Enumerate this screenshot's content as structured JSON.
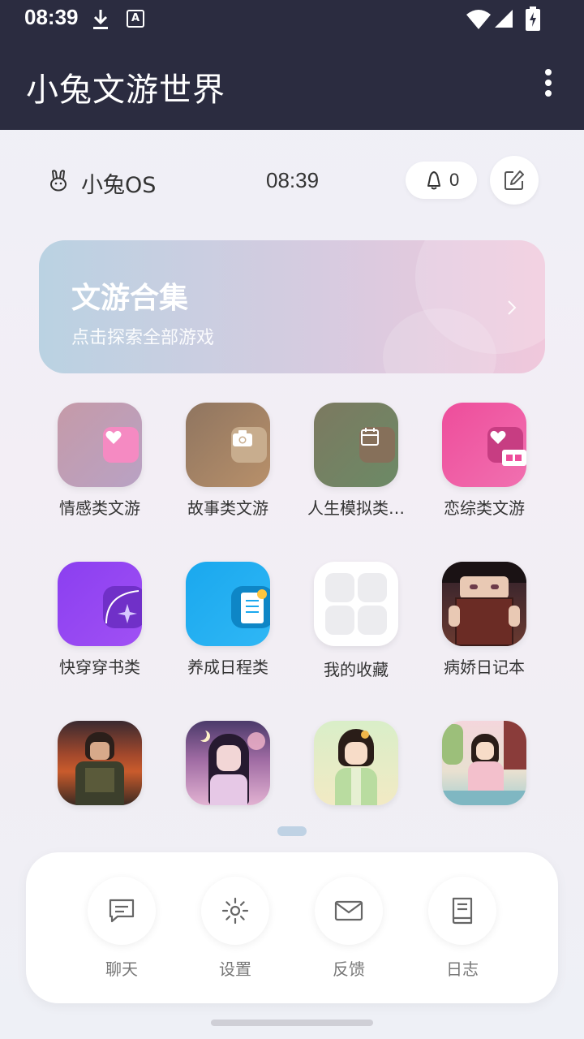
{
  "status_bar": {
    "time": "08:39",
    "keyboard_badge": "A"
  },
  "app_bar": {
    "title": "小兔文游世界"
  },
  "info_row": {
    "os_label": "小兔OS",
    "clock": "08:39",
    "notification_count": "0"
  },
  "banner": {
    "title": "文游合集",
    "subtitle": "点击探索全部游戏",
    "chevron": "›"
  },
  "apps": [
    {
      "label": "情感类文游",
      "icon": "heart-icon"
    },
    {
      "label": "故事类文游",
      "icon": "camera-icon"
    },
    {
      "label": "人生模拟类…",
      "icon": "calendar-icon"
    },
    {
      "label": "恋综类文游",
      "icon": "heart-icon"
    },
    {
      "label": "快穿穿书类",
      "icon": "sparkle-icon"
    },
    {
      "label": "养成日程类",
      "icon": "document-icon"
    },
    {
      "label": "我的收藏",
      "icon": "grid-icon"
    },
    {
      "label": "病娇日记本",
      "icon": "girl-reading-book-image"
    },
    {
      "label": "",
      "icon": "soldier-portrait-image"
    },
    {
      "label": "",
      "icon": "moonlit-girl-image"
    },
    {
      "label": "",
      "icon": "hanfu-girl-image"
    },
    {
      "label": "",
      "icon": "garden-girl-image"
    }
  ],
  "dock": [
    {
      "label": "聊天",
      "icon": "chat-icon"
    },
    {
      "label": "设置",
      "icon": "gear-icon"
    },
    {
      "label": "反馈",
      "icon": "mail-icon"
    },
    {
      "label": "日志",
      "icon": "book-icon"
    }
  ],
  "colors": {
    "app_bar": "#2b2c40",
    "accent_pink": "#ee4d9b",
    "accent_purple": "#8b3ff0",
    "accent_blue": "#19a9ef"
  }
}
